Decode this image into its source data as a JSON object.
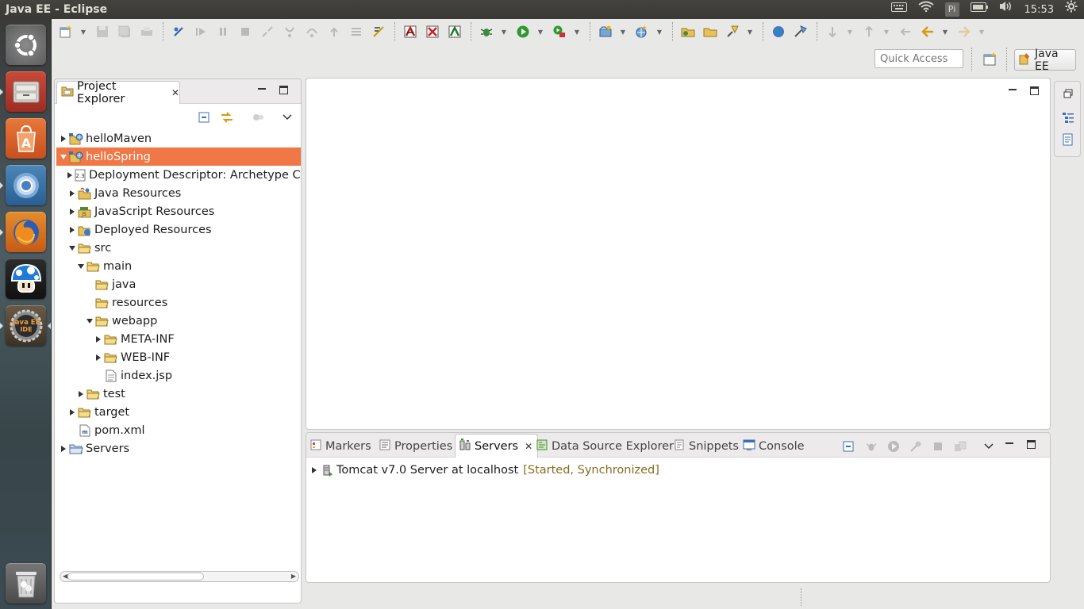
{
  "window": {
    "title": "Java EE - Eclipse"
  },
  "system_tray": {
    "clock": "15:53",
    "user_initial": "Pi"
  },
  "launcher": {
    "items": [
      "ubuntu-dash",
      "files",
      "software-center",
      "chromium",
      "firefox",
      "mushroom-app",
      "java-ee-ide"
    ],
    "java_ee_label": "Java EE IDE"
  },
  "toolbar": {
    "quick_access_placeholder": "Quick Access",
    "perspective_label": "Java EE"
  },
  "project_explorer": {
    "title": "Project Explorer",
    "tree": [
      {
        "label": "helloMaven",
        "depth": 0,
        "twisty": "closed",
        "icon": "web-project-icon"
      },
      {
        "label": "helloSpring",
        "depth": 0,
        "twisty": "open",
        "icon": "web-project-icon",
        "selected": true
      },
      {
        "label": "Deployment Descriptor: Archetype Crea",
        "depth": 1,
        "twisty": "closed",
        "icon": "deployment-descriptor-icon"
      },
      {
        "label": "Java Resources",
        "depth": 1,
        "twisty": "closed",
        "icon": "java-resources-icon"
      },
      {
        "label": "JavaScript Resources",
        "depth": 1,
        "twisty": "closed",
        "icon": "javascript-resources-icon"
      },
      {
        "label": "Deployed Resources",
        "depth": 1,
        "twisty": "closed",
        "icon": "deployed-resources-icon"
      },
      {
        "label": "src",
        "depth": 1,
        "twisty": "open",
        "icon": "folder-icon"
      },
      {
        "label": "main",
        "depth": 2,
        "twisty": "open",
        "icon": "folder-icon"
      },
      {
        "label": "java",
        "depth": 3,
        "twisty": "none",
        "icon": "folder-icon"
      },
      {
        "label": "resources",
        "depth": 3,
        "twisty": "none",
        "icon": "folder-icon"
      },
      {
        "label": "webapp",
        "depth": 3,
        "twisty": "open",
        "icon": "folder-icon"
      },
      {
        "label": "META-INF",
        "depth": 4,
        "twisty": "closed",
        "icon": "folder-icon"
      },
      {
        "label": "WEB-INF",
        "depth": 4,
        "twisty": "closed",
        "icon": "folder-icon"
      },
      {
        "label": "index.jsp",
        "depth": 4,
        "twisty": "none",
        "icon": "file-icon"
      },
      {
        "label": "test",
        "depth": 2,
        "twisty": "closed",
        "icon": "folder-icon"
      },
      {
        "label": "target",
        "depth": 1,
        "twisty": "closed",
        "icon": "folder-icon"
      },
      {
        "label": "pom.xml",
        "depth": 1,
        "twisty": "none",
        "icon": "xml-file-icon"
      },
      {
        "label": "Servers",
        "depth": 0,
        "twisty": "closed",
        "icon": "servers-folder-icon"
      }
    ]
  },
  "bottom_panel": {
    "tabs": [
      {
        "label": "Markers",
        "icon": "markers-icon"
      },
      {
        "label": "Properties",
        "icon": "properties-icon"
      },
      {
        "label": "Servers",
        "icon": "servers-icon",
        "active": true
      },
      {
        "label": "Data Source Explorer",
        "icon": "data-source-icon"
      },
      {
        "label": "Snippets",
        "icon": "snippets-icon"
      },
      {
        "label": "Console",
        "icon": "console-icon"
      }
    ],
    "server": {
      "name": "Tomcat v7.0 Server at localhost",
      "status": "[Started, Synchronized]"
    }
  },
  "colors": {
    "selection": "#f07746",
    "title_bar": "#3c3b37",
    "panel_bg": "#ffffff",
    "chrome_bg": "#e8e8e7",
    "server_status": "#8a6a1f"
  }
}
